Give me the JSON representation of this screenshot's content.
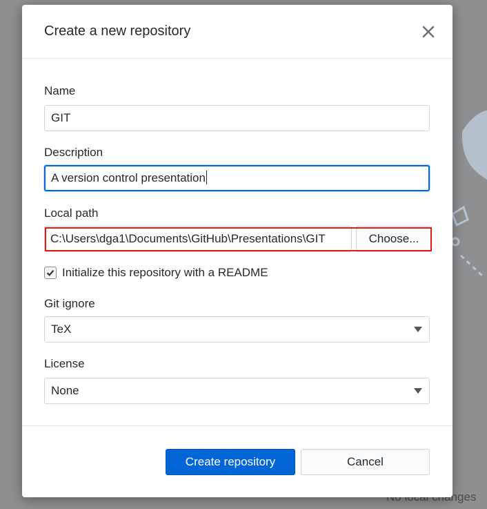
{
  "dialog": {
    "title": "Create a new repository",
    "close_icon": "close-icon"
  },
  "fields": {
    "name": {
      "label": "Name",
      "value": "GIT"
    },
    "description": {
      "label": "Description",
      "value": "A version control presentation"
    },
    "local_path": {
      "label": "Local path",
      "value": "C:\\Users\\dga1\\Documents\\GitHub\\Presentations\\GIT",
      "choose_label": "Choose..."
    },
    "readme": {
      "label": "Initialize this repository with a README",
      "checked": true
    },
    "gitignore": {
      "label": "Git ignore",
      "selected": "TeX"
    },
    "license": {
      "label": "License",
      "selected": "None"
    }
  },
  "footer": {
    "create_label": "Create repository",
    "cancel_label": "Cancel"
  },
  "background": {
    "status_text": "No local changes"
  },
  "colors": {
    "primary": "#0366d6",
    "highlight": "#e01919"
  }
}
